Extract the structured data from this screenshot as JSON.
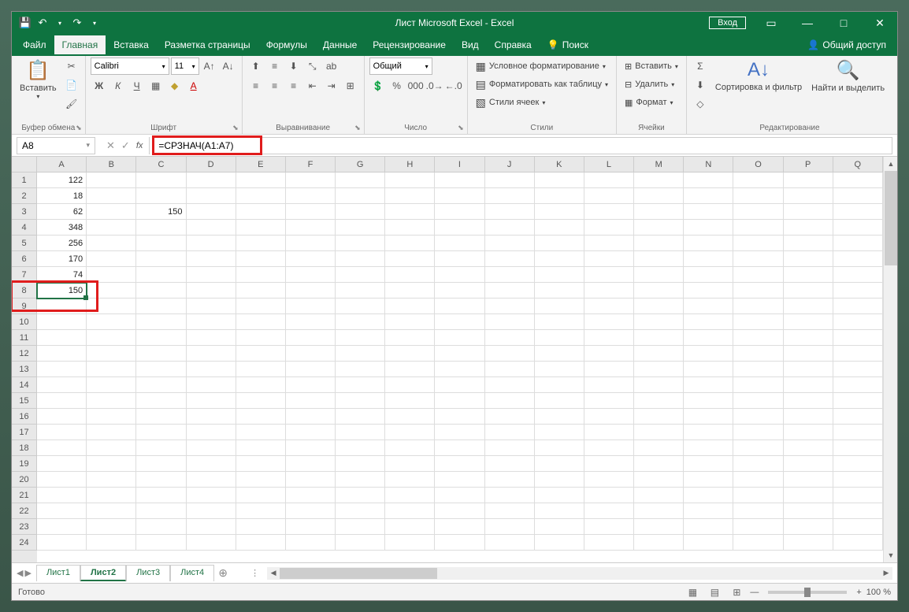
{
  "title": "Лист Microsoft Excel - Excel",
  "login": "Вход",
  "menu": {
    "file": "Файл",
    "home": "Главная",
    "insert": "Вставка",
    "layout": "Разметка страницы",
    "formulas": "Формулы",
    "data": "Данные",
    "review": "Рецензирование",
    "view": "Вид",
    "help": "Справка",
    "search": "Поиск",
    "share": "Общий доступ"
  },
  "ribbon": {
    "paste": "Вставить",
    "clipboard": "Буфер обмена",
    "font_name": "Calibri",
    "font_size": "11",
    "font": "Шрифт",
    "alignment": "Выравнивание",
    "number_format": "Общий",
    "number": "Число",
    "cond_format": "Условное форматирование",
    "as_table": "Форматировать как таблицу",
    "cell_styles": "Стили ячеек",
    "styles": "Стили",
    "insert_cells": "Вставить",
    "delete_cells": "Удалить",
    "format": "Формат",
    "cells": "Ячейки",
    "sort_filter": "Сортировка и фильтр",
    "find_select": "Найти и выделить",
    "editing": "Редактирование"
  },
  "namebox": "A8",
  "formula": "=СРЗНАЧ(A1:A7)",
  "columns": [
    "A",
    "B",
    "C",
    "D",
    "E",
    "F",
    "G",
    "H",
    "I",
    "J",
    "K",
    "L",
    "M",
    "N",
    "O",
    "P",
    "Q"
  ],
  "rows": [
    "1",
    "2",
    "3",
    "4",
    "5",
    "6",
    "7",
    "8",
    "9",
    "10",
    "11",
    "12",
    "13",
    "14",
    "15",
    "16",
    "17",
    "18",
    "19",
    "20",
    "21",
    "22",
    "23",
    "24"
  ],
  "cells": {
    "A1": "122",
    "A2": "18",
    "A3": "62",
    "C3": "150",
    "A4": "348",
    "A5": "256",
    "A6": "170",
    "A7": "74",
    "A8": "150"
  },
  "selected": "A8",
  "sheets": [
    "Лист1",
    "Лист2",
    "Лист3",
    "Лист4"
  ],
  "active_sheet": "Лист2",
  "status": "Готово",
  "zoom": "100 %"
}
